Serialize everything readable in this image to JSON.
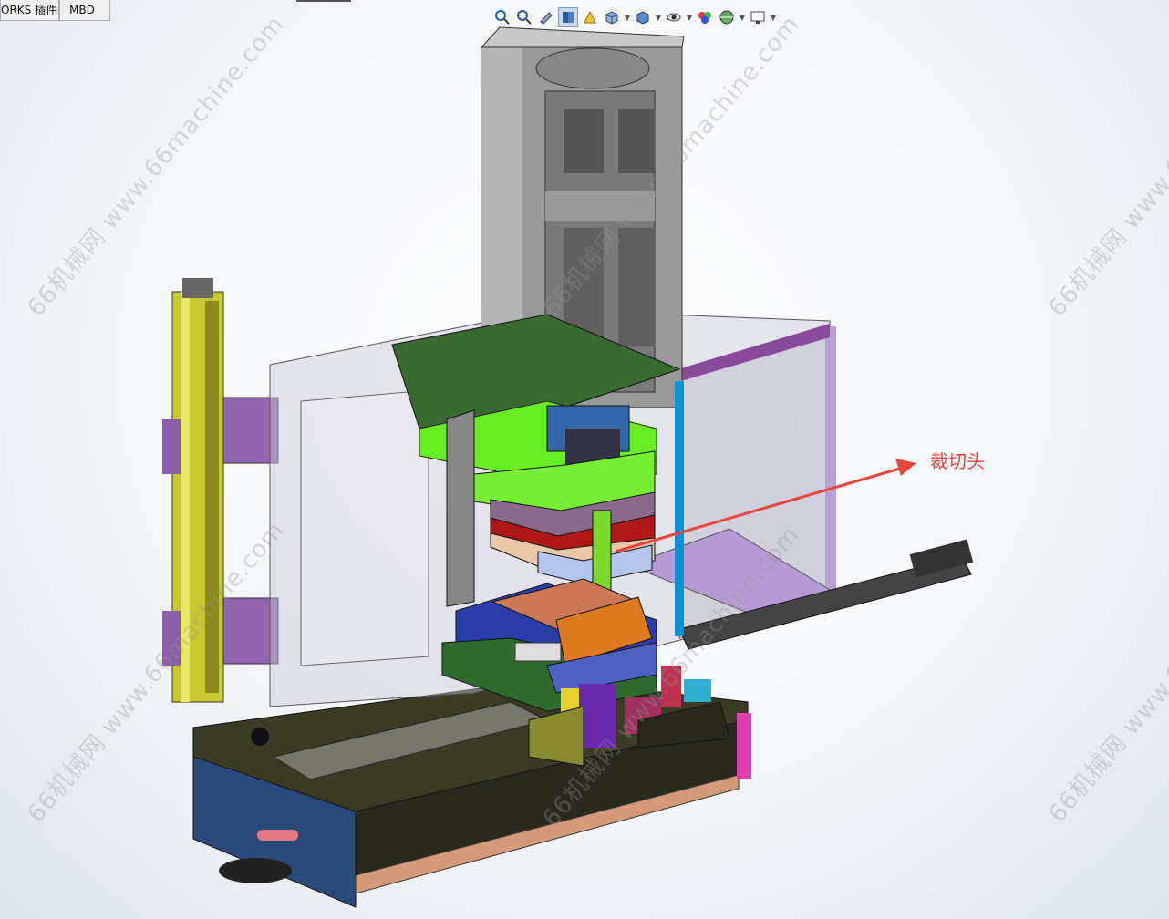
{
  "tabs": [
    {
      "label": "ORKS 插件"
    },
    {
      "label": "MBD"
    }
  ],
  "hud": {
    "icons": [
      "zoom-to-fit-icon",
      "zoom-area-icon",
      "previous-view-icon",
      "section-view-icon",
      "dynamic-annotation-icon",
      "view-orientation-icon",
      "display-style-icon",
      "hide-show-icon",
      "edit-appearance-icon",
      "apply-scene-icon",
      "view-settings-icon"
    ]
  },
  "callout": {
    "label": "裁切头",
    "color": "#e8453c"
  },
  "watermark": {
    "text": "66机械网 www.66machine.com"
  },
  "colors": {
    "cylinder": "#9a9a9a",
    "green_plate": "#66ee22",
    "red_plate": "#b01818",
    "purple": "#8855aa",
    "blue": "#3b57b8",
    "orange": "#e07a20",
    "yellow_rail": "#c8c830",
    "base": "#3a3a28",
    "magenta": "#e040b0",
    "cyan": "#1090d0"
  }
}
